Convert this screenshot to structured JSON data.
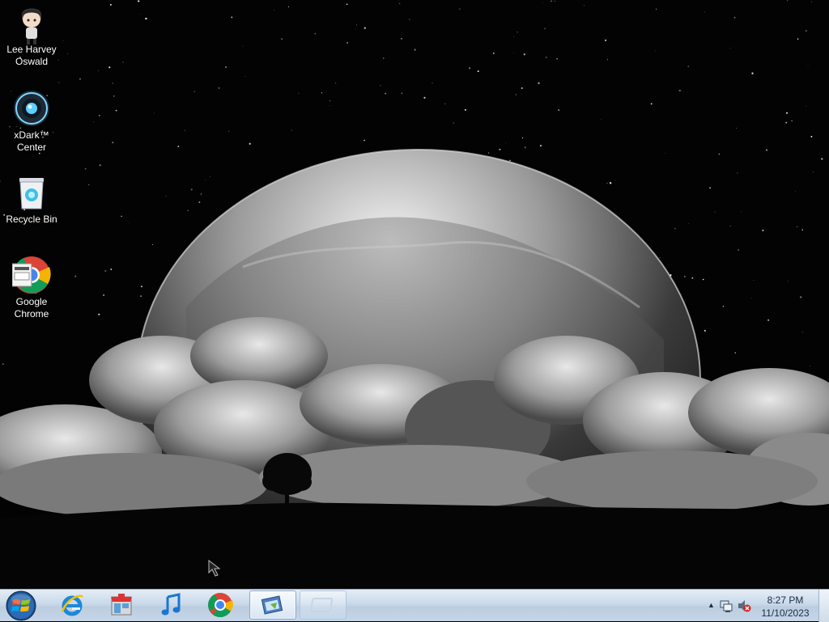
{
  "desktop": {
    "icons": [
      {
        "label": "Lee Harvey\nOswald",
        "icon": "anime-character-icon"
      },
      {
        "label": "xDark™\nCenter",
        "icon": "xdark-center-icon"
      },
      {
        "label": "Recycle Bin",
        "icon": "recycle-bin-icon"
      },
      {
        "label": "Google\nChrome",
        "icon": "chrome-shortcut-icon"
      }
    ]
  },
  "taskbar": {
    "start": {
      "icon": "windows-start-orb-icon"
    },
    "pinned": [
      {
        "icon": "internet-explorer-icon"
      },
      {
        "icon": "store-icon"
      },
      {
        "icon": "music-note-icon"
      },
      {
        "icon": "google-chrome-icon"
      },
      {
        "icon": "control-panel-window-icon",
        "state": "active"
      },
      {
        "icon": "blank-window-icon",
        "state": "ghost"
      }
    ],
    "tray": {
      "icons": [
        "show-hidden-icons-arrow",
        "network-icon",
        "volume-muted-icon"
      ],
      "time": "8:27 PM",
      "date": "11/10/2023"
    }
  },
  "colors": {
    "taskbar_top": "#e4edf6",
    "taskbar_bottom": "#c6d6e8",
    "clock_text": "#1a2c44",
    "desktop_label": "#ffffff"
  }
}
